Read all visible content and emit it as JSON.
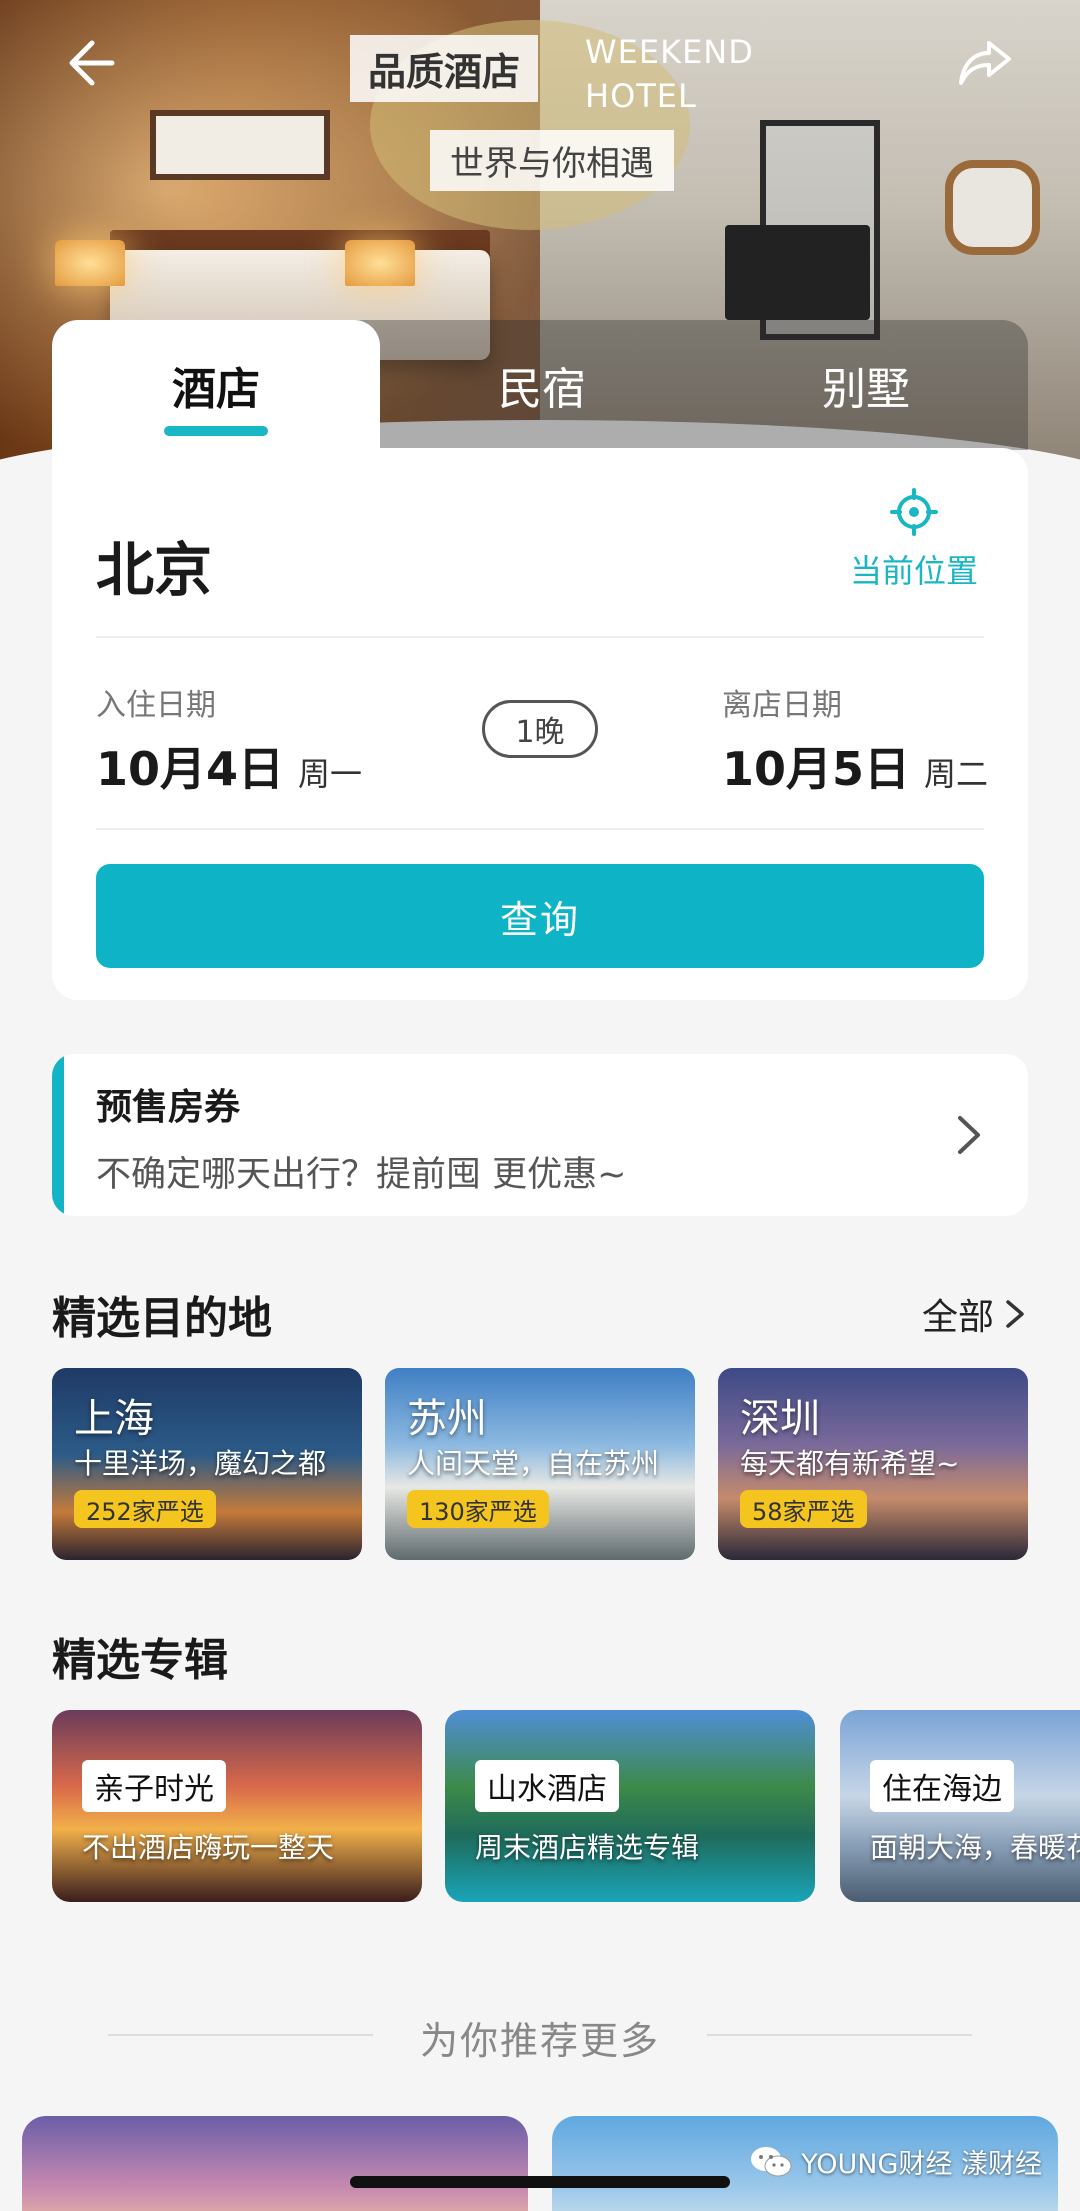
{
  "hero": {
    "tag_quality": "品质酒店",
    "tag_weekend_line1": "WEEKEND",
    "tag_weekend_line2": "HOTEL",
    "tag_slogan": "世界与你相遇"
  },
  "tabs": [
    {
      "label": "酒店",
      "active": true
    },
    {
      "label": "民宿",
      "active": false
    },
    {
      "label": "别墅",
      "active": false
    }
  ],
  "search": {
    "city": "北京",
    "location_label": "当前位置",
    "checkin_label": "入住日期",
    "checkin_date": "10月4日",
    "checkin_weekday": "周一",
    "nights": "1晚",
    "checkout_label": "离店日期",
    "checkout_date": "10月5日",
    "checkout_weekday": "周二",
    "query_button": "查询"
  },
  "presale": {
    "title": "预售房券",
    "subtitle": "不确定哪天出行？提前囤 更优惠~"
  },
  "destinations": {
    "title": "精选目的地",
    "more": "全部",
    "items": [
      {
        "name": "上海",
        "sub": "十里洋场，魔幻之都",
        "badge": "252家严选"
      },
      {
        "name": "苏州",
        "sub": "人间天堂，自在苏州",
        "badge": "130家严选"
      },
      {
        "name": "深圳",
        "sub": "每天都有新希望~",
        "badge": "58家严选"
      }
    ]
  },
  "albums": {
    "title": "精选专辑",
    "items": [
      {
        "label": "亲子时光",
        "sub": "不出酒店嗨玩一整天"
      },
      {
        "label": "山水酒店",
        "sub": "周末酒店精选专辑"
      },
      {
        "label": "住在海边",
        "sub": "面朝大海，春暖花开"
      }
    ]
  },
  "recommend": {
    "title": "为你推荐更多"
  },
  "watermark": "YOUNG财经 漾财经",
  "colors": {
    "accent": "#0fb3c6",
    "badge": "#f4c51f"
  }
}
